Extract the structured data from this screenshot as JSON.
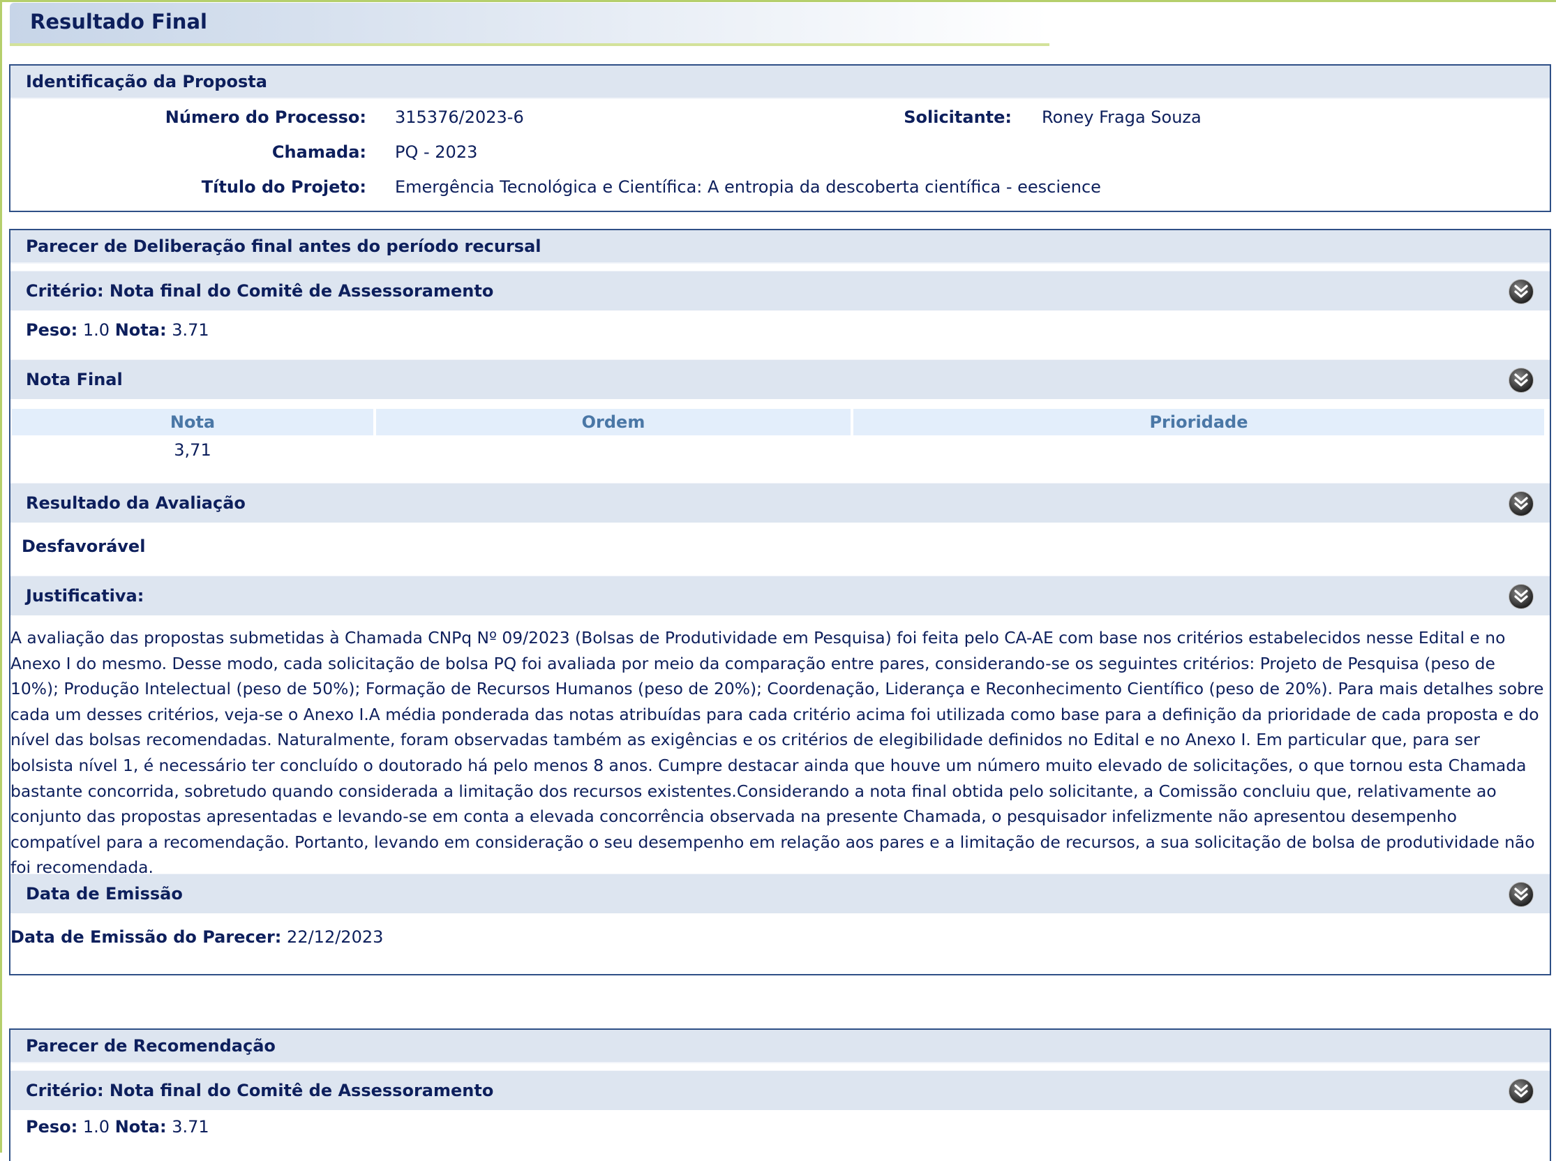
{
  "page": {
    "title": "Resultado Final"
  },
  "identificacao": {
    "heading": "Identificação da Proposta",
    "numero_label": "Número do Processo:",
    "numero_value": "315376/2023-6",
    "solicitante_label": "Solicitante:",
    "solicitante_value": "Roney Fraga Souza",
    "chamada_label": "Chamada:",
    "chamada_value": "PQ - 2023",
    "titulo_label": "Título do Projeto:",
    "titulo_value": "Emergência Tecnológica e Científica: A entropia da descoberta científica - eescience"
  },
  "deliberacao": {
    "heading": "Parecer de Deliberação final antes do período recursal",
    "criterio_heading": "Critério: Nota final do Comitê de Assessoramento",
    "peso_label": "Peso:",
    "peso_value": "1.0",
    "nota_label": "Nota:",
    "nota_value": "3.71",
    "nota_final_heading": "Nota Final",
    "table": {
      "headers": [
        "Nota",
        "Ordem",
        "Prioridade"
      ],
      "row": [
        "3,71",
        "",
        ""
      ]
    },
    "resultado_heading": "Resultado da Avaliação",
    "resultado_value": "Desfavorável",
    "justificativa_heading": "Justificativa:",
    "justificativa_text": "A avaliação das propostas submetidas à Chamada CNPq Nº 09/2023 (Bolsas de Produtividade em Pesquisa) foi feita pelo CA-AE com base nos critérios estabelecidos nesse Edital e no Anexo I do mesmo. Desse modo, cada solicitação de bolsa PQ foi avaliada por meio da comparação entre pares, considerando-se os seguintes critérios: Projeto de Pesquisa (peso de 10%); Produção Intelectual (peso de 50%); Formação de Recursos Humanos (peso de 20%); Coordenação, Liderança e Reconhecimento Científico (peso de 20%). Para mais detalhes sobre cada um desses critérios, veja-se o Anexo I.A média ponderada das notas atribuídas para cada critério acima foi utilizada como base para a definição da prioridade de cada proposta e do nível das bolsas recomendadas. Naturalmente, foram observadas também as exigências e os critérios de elegibilidade definidos no Edital e no Anexo I. Em particular que, para ser bolsista nível 1, é necessário ter concluído o doutorado há pelo menos 8 anos. Cumpre destacar ainda que houve um número muito elevado de solicitações, o que tornou esta Chamada bastante concorrida, sobretudo quando considerada a limitação dos recursos existentes.Considerando a nota final obtida pelo solicitante, a Comissão concluiu que, relativamente ao conjunto das propostas apresentadas e levando-se em conta a elevada concorrência observada na presente Chamada, o pesquisador infelizmente não apresentou desempenho compatível para a recomendação. Portanto, levando em consideração o seu desempenho em relação aos pares e a limitação de recursos, a sua solicitação de bolsa de produtividade não foi recomendada.",
    "data_heading": "Data de Emissão",
    "data_label": "Data de Emissão do Parecer:",
    "data_value": "22/12/2023"
  },
  "recomendacao": {
    "heading": "Parecer de Recomendação",
    "criterio_heading": "Critério: Nota final do Comitê de Assessoramento",
    "peso_label": "Peso:",
    "peso_value": "1.0",
    "nota_label": "Nota:",
    "nota_value": "3.71"
  },
  "icons": {
    "collapse": "double-chevron-down-icon"
  },
  "colors": {
    "header_bg": "#dde5f0",
    "border": "#2e4f86",
    "text": "#0d1f5c",
    "table_header_text": "#4a77a6",
    "accent_green": "#b5cf6c"
  }
}
